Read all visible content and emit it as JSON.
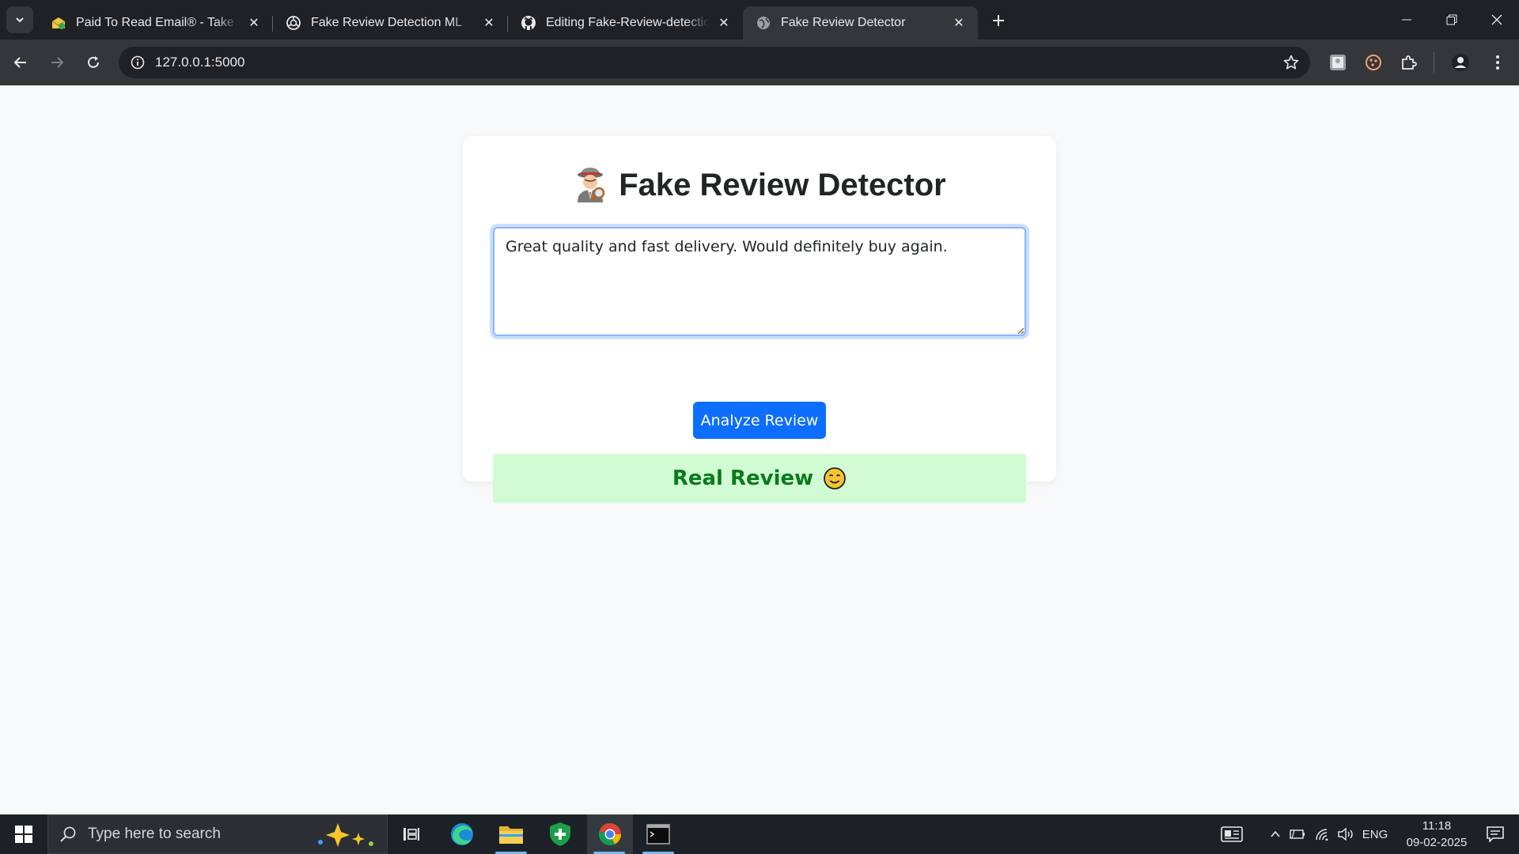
{
  "browser": {
    "tabs": [
      {
        "title": "Paid To Read Email® - Take Paid",
        "favicon": "envelope-money-icon",
        "active": false
      },
      {
        "title": "Fake Review Detection ML",
        "favicon": "openai-icon",
        "active": false
      },
      {
        "title": "Editing Fake-Review-detection-ML",
        "favicon": "github-icon",
        "active": false
      },
      {
        "title": "Fake Review Detector",
        "favicon": "globe-icon",
        "active": true
      }
    ],
    "address": "127.0.0.1:5000"
  },
  "page": {
    "title": "Fake Review Detector",
    "title_icon": "detective-emoji",
    "review_text": "Great quality and fast delivery. Would definitely buy again.",
    "analyze_label": "Analyze Review",
    "result_text": "Real Review",
    "result_icon": "smiling-face-emoji",
    "colors": {
      "accent": "#0d6efd",
      "result_bg": "#d1fcd3",
      "result_text": "#0a7a1e"
    }
  },
  "taskbar": {
    "search_placeholder": "Type here to search",
    "language": "ENG",
    "time": "11:18",
    "date": "09-02-2025"
  }
}
